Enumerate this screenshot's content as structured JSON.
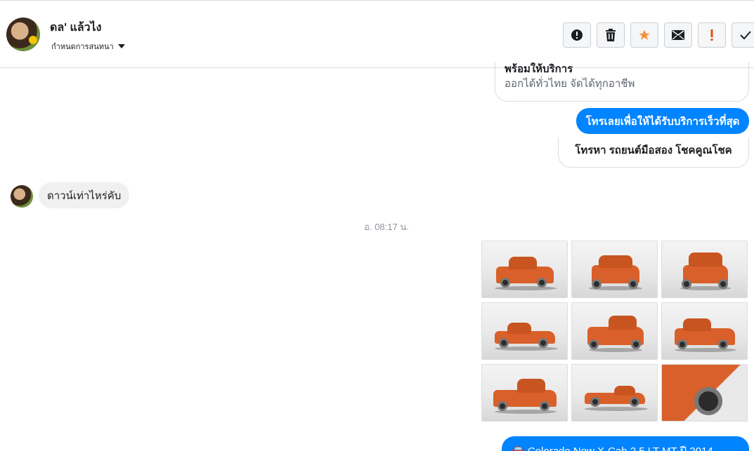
{
  "header": {
    "contact_name": "ดล' แล้วไง",
    "assign_label": "กำหนดการสนทนา"
  },
  "toolbar": {
    "buttons": [
      {
        "name": "report-icon",
        "color": "#1c1e21"
      },
      {
        "name": "trash-icon",
        "color": "#1c1e21"
      },
      {
        "name": "star-icon",
        "color": "#f7923b"
      },
      {
        "name": "envelope-icon",
        "color": "#1c1e21"
      },
      {
        "name": "exclamation-icon",
        "color": "#e2500f"
      },
      {
        "name": "checkmark-icon",
        "color": "#1c1e21"
      }
    ]
  },
  "messages": {
    "card_title": "พร้อมให้บริการ",
    "card_subtitle": "ออกได้ทั่วไทย จัดได้ทุกอาชีพ",
    "call_button": "โทรเลยเพื่อให้ได้รับบริการเร็วที่สุด",
    "call_alt_button": "โทรหา รถยนต์มือสอง โชคคูณโชค",
    "incoming_text": "ดาวน์เท่าไหร่คับ",
    "timestamp": "อ. 08:17 น.",
    "bottom_text": "🚘 Colorado New X-Cab 2.5 LT MT ปี 2014"
  },
  "colors": {
    "messenger_blue": "#0084ff",
    "incoming_bg": "#f1f0f0",
    "car_orange": "#d9602a"
  }
}
